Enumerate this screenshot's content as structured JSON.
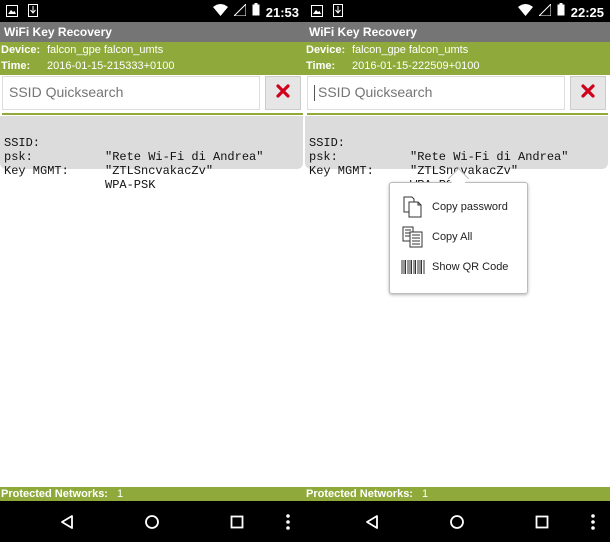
{
  "screens": [
    {
      "status": {
        "time": "21:53"
      },
      "app_title": "WiFi Key Recovery",
      "device_label": "Device:",
      "device_value": "falcon_gpe falcon_umts",
      "time_label": "Time:",
      "time_value": "2016-01-15-215333+0100",
      "search": {
        "placeholder": "SSID Quicksearch",
        "value": ""
      },
      "network": {
        "ssid_key": "SSID:",
        "ssid_value": "\"Rete Wi-Fi di Andrea\"",
        "psk_key": "psk:",
        "psk_value": "\"ZTLSncvakacZv\"",
        "mgmt_key": "Key MGMT:",
        "mgmt_value": "WPA-PSK"
      },
      "footer_label": "Protected Networks:",
      "footer_count": "1"
    },
    {
      "status": {
        "time": "22:25"
      },
      "app_title": "WiFi Key Recovery",
      "device_label": "Device:",
      "device_value": "falcon_gpe falcon_umts",
      "time_label": "Time:",
      "time_value": "2016-01-15-222509+0100",
      "search": {
        "placeholder": "SSID Quicksearch",
        "value": ""
      },
      "network": {
        "ssid_key": "SSID:",
        "ssid_value": "\"Rete Wi-Fi di Andrea\"",
        "psk_key": "psk:",
        "psk_value": "\"ZTLSncvakacZv\"",
        "mgmt_key": "Key MGMT:",
        "mgmt_value": "WPA-PSK"
      },
      "context_menu": [
        {
          "label": "Copy password",
          "icon": "copy-icon"
        },
        {
          "label": "Copy All",
          "icon": "copy-all-icon"
        },
        {
          "label": "Show QR Code",
          "icon": "barcode-icon"
        }
      ],
      "footer_label": "Protected Networks:",
      "footer_count": "1"
    }
  ],
  "colors": {
    "accent_green": "#8faa3b",
    "titlebar_gray": "#757575",
    "card_gray": "#dcdcdc",
    "clear_red": "#d0021b"
  },
  "status_icons": [
    "image-icon",
    "download-icon",
    "wifi-icon",
    "signal-icon",
    "battery-icon"
  ],
  "nav_icons": [
    "back-icon",
    "home-icon",
    "recents-icon",
    "more-icon"
  ]
}
